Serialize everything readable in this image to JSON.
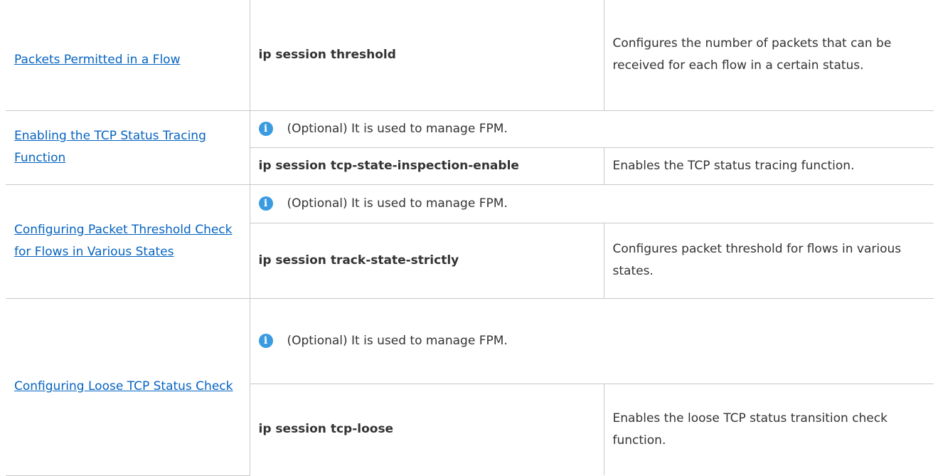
{
  "rows": [
    {
      "task_link": "Packets Permitted in a Flow",
      "command": "ip session threshold",
      "description": "Configures the number of packets that can be received for each flow in a certain status."
    },
    {
      "task_link": "Enabling the TCP Status Tracing Function",
      "note": "(Optional) It is used to manage FPM.",
      "command": "ip session tcp-state-inspection-enable",
      "description": "Enables the TCP status tracing function."
    },
    {
      "task_link": "Configuring Packet Threshold Check for Flows in Various States",
      "note": "(Optional) It is used to manage FPM.",
      "command": "ip session track-state-strictly",
      "description": "Configures packet threshold for flows in various states."
    },
    {
      "task_link": "Configuring Loose TCP Status Check",
      "note": "(Optional) It is used to manage FPM.",
      "command": "ip session tcp-loose",
      "description": "Enables the loose TCP status transition check function."
    }
  ],
  "icons": {
    "note_icon": "info-icon",
    "note_icon_glyph": "i",
    "note_icon_color": "#3b9be0"
  },
  "colors": {
    "link": "#0563c1",
    "border": "#c8c8c8",
    "text": "#333333"
  }
}
